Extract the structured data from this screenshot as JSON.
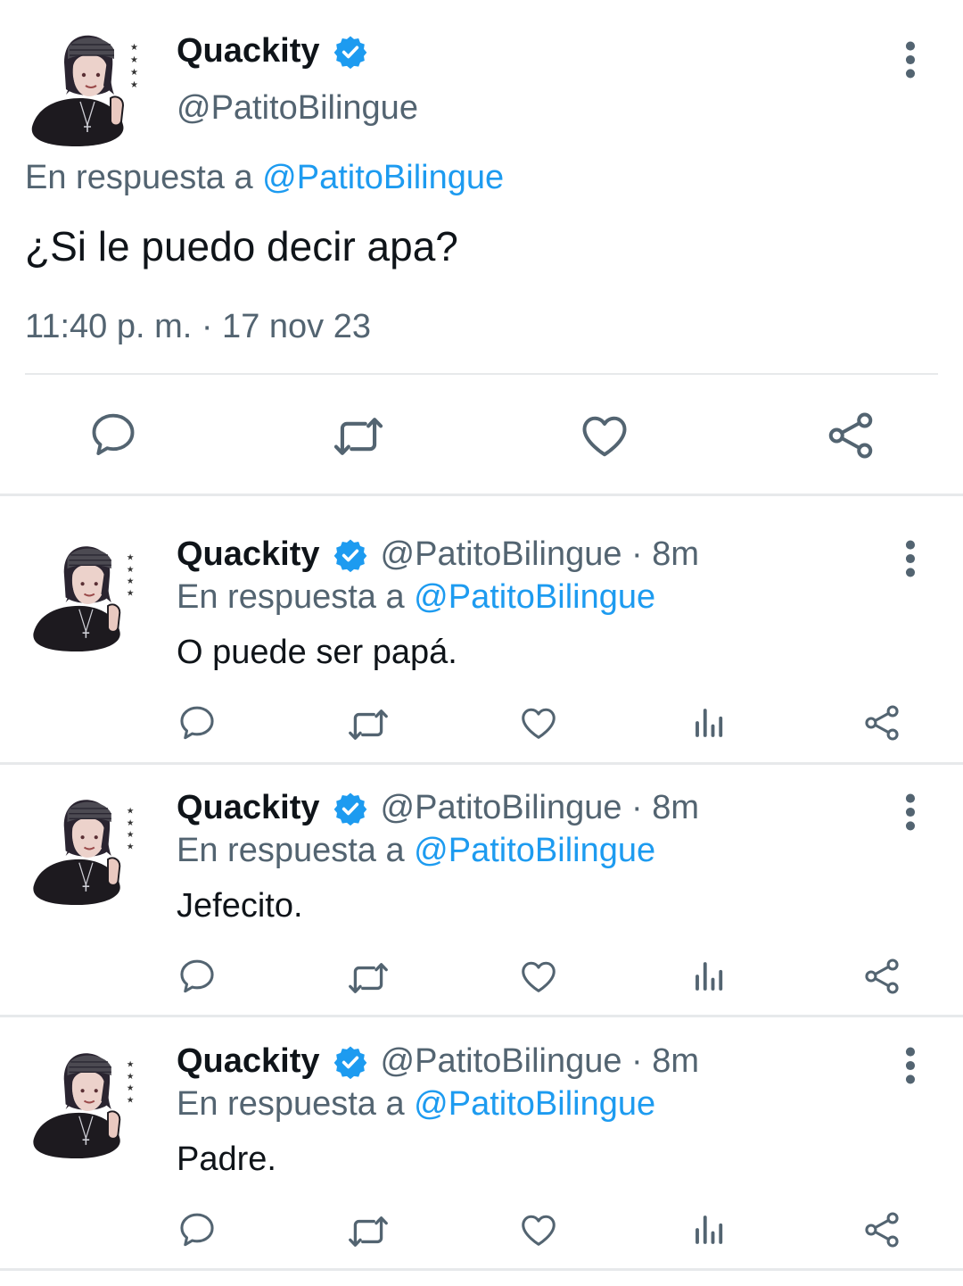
{
  "colors": {
    "accent": "#1d9bf0",
    "secondary_text": "#536471",
    "divider": "#e7e9eb"
  },
  "main_tweet": {
    "display_name": "Quackity",
    "handle": "@PatitoBilingue",
    "reply_prefix": "En respuesta a ",
    "reply_handle": "@PatitoBilingue",
    "text": "¿Si le puedo decir apa?",
    "meta": "11:40 p. m. · 17 nov 23",
    "icons": [
      "reply-icon",
      "retweet-icon",
      "like-icon",
      "share-icon"
    ]
  },
  "replies": [
    {
      "display_name": "Quackity",
      "handle_time": "@PatitoBilingue · 8m",
      "reply_prefix": "En respuesta a ",
      "reply_handle": "@PatitoBilingue",
      "text": "O puede ser papá."
    },
    {
      "display_name": "Quackity",
      "handle_time": "@PatitoBilingue · 8m",
      "reply_prefix": "En respuesta a ",
      "reply_handle": "@PatitoBilingue",
      "text": "Jefecito."
    },
    {
      "display_name": "Quackity",
      "handle_time": "@PatitoBilingue · 8m",
      "reply_prefix": "En respuesta a ",
      "reply_handle": "@PatitoBilingue",
      "text": "Padre."
    }
  ]
}
